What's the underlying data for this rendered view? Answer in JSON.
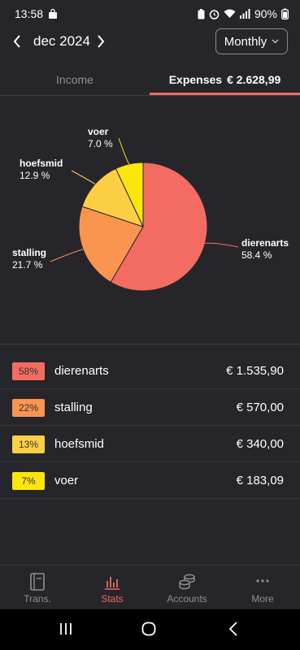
{
  "status_bar": {
    "time": "13:58",
    "battery": "90%"
  },
  "header": {
    "month": "dec 2024",
    "period": "Monthly"
  },
  "tabs": {
    "income": "Income",
    "expenses": "Expenses",
    "expenses_total": "€ 2.628,99"
  },
  "chart_data": {
    "type": "pie",
    "slices": [
      {
        "label": "dierenarts",
        "percent_label": "58.4 %",
        "value": 58.4,
        "color": "#f46c61"
      },
      {
        "label": "stalling",
        "percent_label": "21.7 %",
        "value": 21.7,
        "color": "#fa9550"
      },
      {
        "label": "hoefsmid",
        "percent_label": "12.9 %",
        "value": 12.9,
        "color": "#fccf45"
      },
      {
        "label": "voer",
        "percent_label": "7.0 %",
        "value": 7.0,
        "color": "#fbe60c"
      }
    ]
  },
  "list": [
    {
      "pct": "58%",
      "name": "dierenarts",
      "amount": "€ 1.535,90",
      "color": "#f46c61"
    },
    {
      "pct": "22%",
      "name": "stalling",
      "amount": "€ 570,00",
      "color": "#fa9550"
    },
    {
      "pct": "13%",
      "name": "hoefsmid",
      "amount": "€ 340,00",
      "color": "#fccf45"
    },
    {
      "pct": "7%",
      "name": "voer",
      "amount": "€ 183,09",
      "color": "#fbe60c"
    }
  ],
  "bottom_nav": [
    {
      "label": "Trans.",
      "icon": "book-icon",
      "active": false
    },
    {
      "label": "Stats",
      "icon": "bar-chart-icon",
      "active": true
    },
    {
      "label": "Accounts",
      "icon": "coins-icon",
      "active": false
    },
    {
      "label": "More",
      "icon": "more-dots-icon",
      "active": false
    }
  ],
  "accent_color": "#f0675f"
}
